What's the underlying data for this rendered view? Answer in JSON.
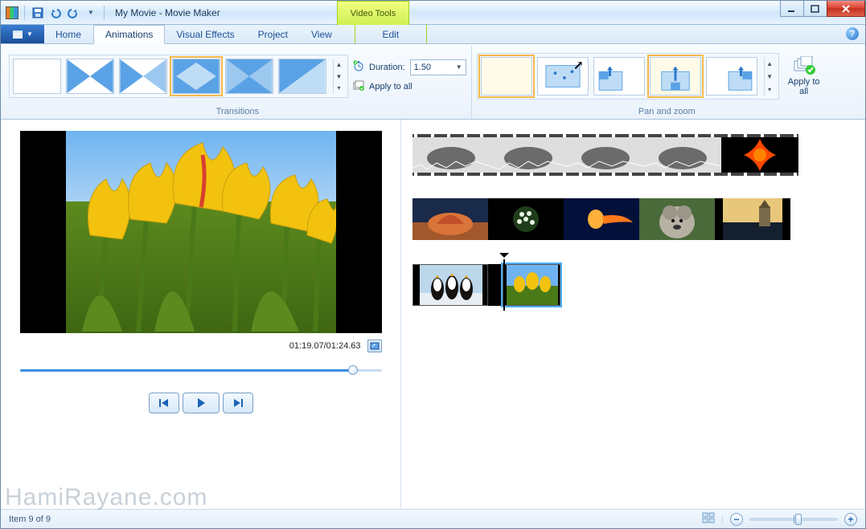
{
  "window": {
    "title": "My Movie - Movie Maker",
    "tool_tab_header": "Video Tools"
  },
  "tabs": {
    "file_glyph": "▤",
    "items": [
      "Home",
      "Animations",
      "Visual Effects",
      "Project",
      "View"
    ],
    "tool_tab": "Edit",
    "active_index": 1
  },
  "ribbon": {
    "transitions": {
      "label": "Transitions",
      "duration_label": "Duration:",
      "duration_value": "1.50",
      "apply_all_label": "Apply to all",
      "items": [
        "none",
        "crossfade-x",
        "crossfade-bowtie",
        "diamond",
        "x-invert",
        "diagonal"
      ],
      "selected_index": 3
    },
    "panzoom": {
      "label": "Pan and zoom",
      "apply_all_label": "Apply to all",
      "items": [
        "none",
        "auto",
        "pan-up-left",
        "pan-up-center",
        "pan-up-right"
      ],
      "selected_index": 3
    }
  },
  "preview": {
    "time_current": "01:19.07",
    "time_total": "01:24.63",
    "progress_pct": 92
  },
  "status": {
    "item_text": "Item 9 of 9"
  },
  "watermark": "HamiRayane.com",
  "timeline": {
    "row1_clips": 5,
    "row2_clips": 5,
    "row3_clips": 2,
    "selected_row3_index": 1
  }
}
